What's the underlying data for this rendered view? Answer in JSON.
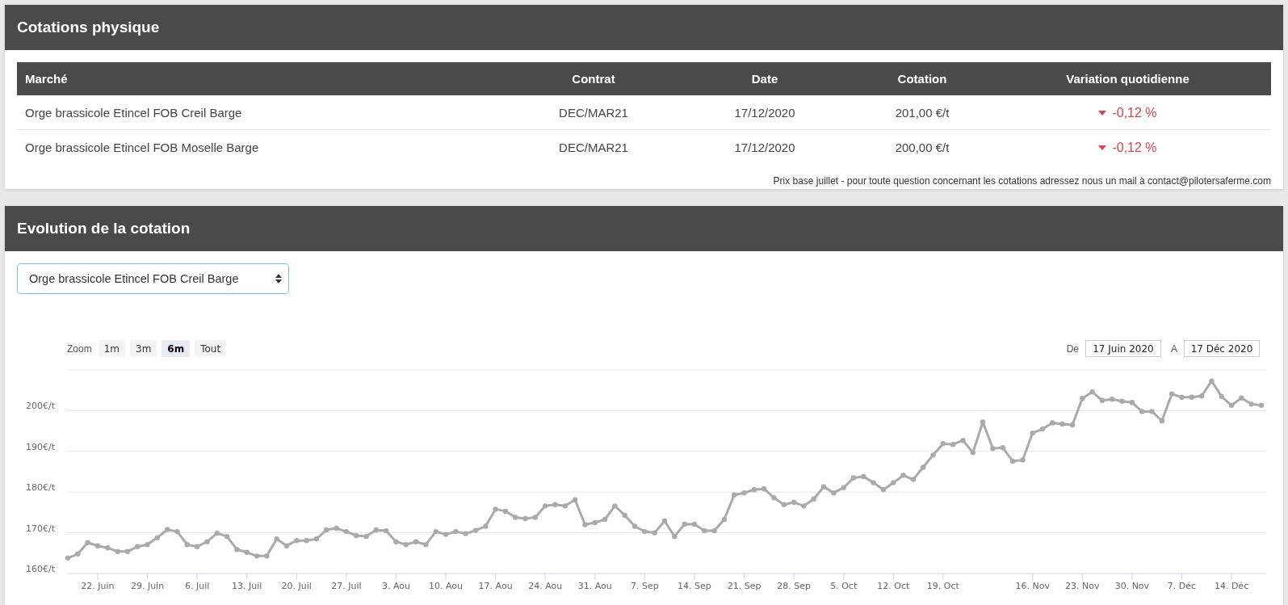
{
  "quotes_panel": {
    "title": "Cotations physique",
    "columns": [
      "Marché",
      "Contrat",
      "Date",
      "Cotation",
      "Variation quotidienne"
    ],
    "rows": [
      {
        "market": "Orge brassicole Etincel FOB Creil Barge",
        "contract": "DEC/MAR21",
        "date": "17/12/2020",
        "price": "201,00 €/t",
        "variation": {
          "kind": "down",
          "text": "-0,12 %"
        }
      },
      {
        "market": "Orge brassicole Etincel FOB Moselle Barge",
        "contract": "DEC/MAR21",
        "date": "17/12/2020",
        "price": "200,00 €/t",
        "variation": {
          "kind": "down",
          "text": "-0,12 %"
        }
      }
    ],
    "note": "Prix base juillet - pour toute question concernant les cotations adressez nous un mail à contact@pilotersaferme.com"
  },
  "evolution_panel": {
    "title": "Evolution de la cotation",
    "select": {
      "value": "Orge brassicole Etincel FOB Creil Barge"
    },
    "range_selector": {
      "label": "Zoom",
      "buttons": [
        {
          "label": "1m",
          "selected": false
        },
        {
          "label": "3m",
          "selected": false
        },
        {
          "label": "6m",
          "selected": true
        },
        {
          "label": "Tout",
          "selected": false
        }
      ]
    },
    "date_range": {
      "from_label": "De",
      "from": "17 Juin 2020",
      "to_label": "A",
      "to": "17 Déc 2020"
    },
    "chart_data": {
      "type": "line",
      "ylim": [
        160,
        210
      ],
      "grid": true,
      "categories": [
        null,
        null,
        null,
        "22. Juin",
        null,
        null,
        null,
        null,
        "29. Juin",
        null,
        null,
        null,
        null,
        "6. Juil",
        null,
        null,
        null,
        null,
        "13. Juil",
        null,
        null,
        null,
        null,
        "20. Juil",
        null,
        null,
        null,
        null,
        "27. Juil",
        null,
        null,
        null,
        null,
        "3. Aou",
        null,
        null,
        null,
        null,
        "10. Aou",
        null,
        null,
        null,
        null,
        "17. Aou",
        null,
        null,
        null,
        null,
        "24. Aou",
        null,
        null,
        null,
        null,
        "31. Aou",
        null,
        null,
        null,
        null,
        "7. Sep",
        null,
        null,
        null,
        null,
        "14. Sep",
        null,
        null,
        null,
        null,
        "21. Sep",
        null,
        null,
        null,
        null,
        "28. Sep",
        null,
        null,
        null,
        null,
        "5. Oct",
        null,
        null,
        null,
        null,
        "12. Oct",
        null,
        null,
        null,
        null,
        "19. Oct",
        null,
        null,
        null,
        null,
        null,
        null,
        null,
        null,
        "16. Nov",
        null,
        null,
        null,
        null,
        "23. Nov",
        null,
        null,
        null,
        null,
        "30. Nov",
        null,
        null,
        null,
        null,
        "7. Déc",
        null,
        null,
        null,
        null,
        "14. Déc",
        null,
        null,
        null
      ],
      "yticks": [
        {
          "value": 160,
          "label": "160€/t"
        },
        {
          "value": 170,
          "label": "170€/t"
        },
        {
          "value": 180,
          "label": "180€/t"
        },
        {
          "value": 190,
          "label": "190€/t"
        },
        {
          "value": 200,
          "label": "200€/t"
        }
      ],
      "series": [
        {
          "color": "#aaaaaa",
          "marker": true,
          "values": [
            163.8,
            164.8,
            167.6,
            166.8,
            166.3,
            165.4,
            165.4,
            166.6,
            167.1,
            168.8,
            170.8,
            170.3,
            167.1,
            166.6,
            167.8,
            169.9,
            169.1,
            165.9,
            165.2,
            164.3,
            164.3,
            168.5,
            166.8,
            168.1,
            168.1,
            168.5,
            170.7,
            171.1,
            170.3,
            169.3,
            169.1,
            170.7,
            170.5,
            167.8,
            167.1,
            167.8,
            167.1,
            170.3,
            169.6,
            170.3,
            169.8,
            170.6,
            171.6,
            175.8,
            175.3,
            173.8,
            173.5,
            173.8,
            176.6,
            176.9,
            176.6,
            178.1,
            172.0,
            172.5,
            173.3,
            176.6,
            174.3,
            171.6,
            170.3,
            170.0,
            172.9,
            169.1,
            172.1,
            172.1,
            170.5,
            170.5,
            173.3,
            179.3,
            179.8,
            180.6,
            180.8,
            178.6,
            176.9,
            177.5,
            176.6,
            178.3,
            181.3,
            179.8,
            181.1,
            183.5,
            183.8,
            182.3,
            180.6,
            182.3,
            184.1,
            183.1,
            186.1,
            189.1,
            191.9,
            191.7,
            192.7,
            189.7,
            197.2,
            190.7,
            190.9,
            187.6,
            187.9,
            194.5,
            195.5,
            197.0,
            196.7,
            196.5,
            203.0,
            204.6,
            202.5,
            202.8,
            202.3,
            202.0,
            199.8,
            199.8,
            197.5,
            204.1,
            203.3,
            203.3,
            203.6,
            207.3,
            203.5,
            201.3,
            203.1,
            201.6,
            201.3
          ]
        }
      ]
    }
  }
}
